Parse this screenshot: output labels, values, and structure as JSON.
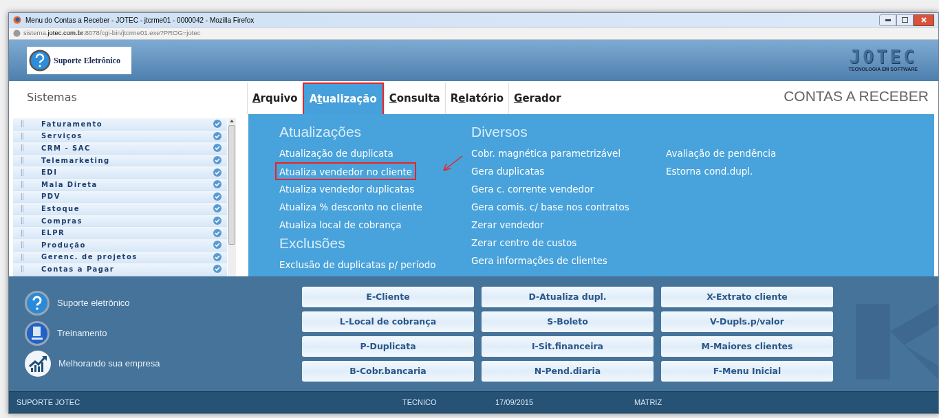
{
  "window": {
    "title": "Menu do Contas a Receber - JOTEC - jtcrme01 - 0000042 - Mozilla Firefox",
    "url_host": "sistema.",
    "url_domain": "jotec.com.br",
    "url_rest": ":8078/cgi-bin/jtcrme01.exe?PROG=jotec"
  },
  "header": {
    "support_label": "Suporte Eletrônico",
    "logo_text": "JOTEC",
    "logo_tagline": "TECNOLOGIA EM SOFTWARE"
  },
  "sidebar": {
    "title": "Sistemas",
    "items": [
      "Faturamento",
      "Serviços",
      "CRM - SAC",
      "Telemarketing",
      "EDI",
      "Mala Direta",
      "PDV",
      "Estoque",
      "Compras",
      "ELPR",
      "Produção",
      "Gerenc. de projetos",
      "Contas a Pagar"
    ]
  },
  "menu_bar": [
    {
      "key": "A",
      "post": "rquivo",
      "selected": false
    },
    {
      "pre": "A",
      "key": "t",
      "post": "ualização",
      "selected": true
    },
    {
      "key": "C",
      "post": "onsulta",
      "selected": false
    },
    {
      "pre": "R",
      "key": "e",
      "post": "latório",
      "selected": false
    },
    {
      "key": "G",
      "post": "erador",
      "selected": false
    }
  ],
  "page_title": "CONTAS A RECEBER",
  "menu_columns": [
    {
      "sections": [
        {
          "title": "Atualizações",
          "items": [
            {
              "label": "Atualização de duplicata",
              "highlighted": false
            },
            {
              "label": "Atualiza vendedor no cliente",
              "highlighted": true
            },
            {
              "label": "Atualiza vendedor duplicatas",
              "highlighted": false
            },
            {
              "label": "Atualiza % desconto no cliente",
              "highlighted": false
            },
            {
              "label": "Atualiza local de cobrança",
              "highlighted": false
            }
          ]
        },
        {
          "title": "Exclusões",
          "items": [
            {
              "label": "Exclusão de duplicatas p/ período",
              "highlighted": false
            }
          ]
        }
      ]
    },
    {
      "sections": [
        {
          "title": "Diversos",
          "items": [
            {
              "label": "Cobr. magnética parametrizável",
              "highlighted": false
            },
            {
              "label": "Gera duplicatas",
              "highlighted": false
            },
            {
              "label": "Gera c. corrente vendedor",
              "highlighted": false
            },
            {
              "label": "Gera comis. c/ base nos contratos",
              "highlighted": false
            },
            {
              "label": "Zerar vendedor",
              "highlighted": false
            },
            {
              "label": "Zerar centro de custos",
              "highlighted": false
            },
            {
              "label": "Gera informações de clientes",
              "highlighted": false
            }
          ]
        }
      ]
    },
    {
      "sections": [
        {
          "items": [
            {
              "label": "Avaliação de pendência",
              "highlighted": false
            },
            {
              "label": "Estorna cond.dupl.",
              "highlighted": false
            }
          ]
        }
      ]
    }
  ],
  "help_links": [
    {
      "kind": "support",
      "label": "Suporte eletrônico"
    },
    {
      "kind": "training",
      "label": "Treinamento"
    },
    {
      "kind": "growth",
      "label": "Melhorando sua empresa"
    }
  ],
  "shortcut_buttons": [
    "E-Cliente",
    "D-Atualiza dupl.",
    "X-Extrato cliente",
    "L-Local de cobrança",
    "S-Boleto",
    "V-Dupls.p/valor",
    "P-Duplicata",
    "I-Sit.financeira",
    "M-Maiores clientes",
    "B-Cobr.bancaria",
    "N-Pend.diaria",
    "F-Menu Inicial"
  ],
  "status_bar": {
    "left": "SUPORTE JOTEC",
    "user": "TECNICO",
    "date": "17/09/2015",
    "branch": "MATRIZ"
  }
}
